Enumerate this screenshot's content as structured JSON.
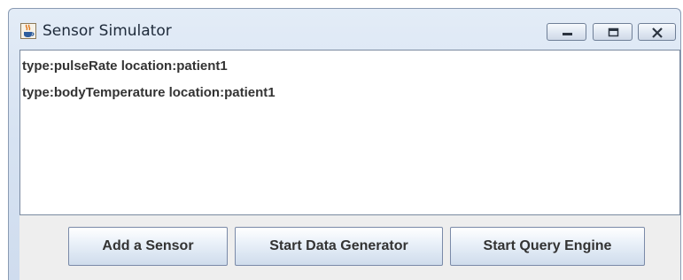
{
  "window": {
    "title": "Sensor Simulator",
    "controls": {
      "minimize_icon": "minimize-icon",
      "maximize_icon": "maximize-icon",
      "close_icon": "close-icon"
    }
  },
  "app_icon": "java-cup-icon",
  "sensor_list": {
    "items": [
      {
        "label": "type:pulseRate location:patient1"
      },
      {
        "label": "type:bodyTemperature location:patient1"
      }
    ]
  },
  "buttons": {
    "add_sensor": "Add a Sensor",
    "start_data_generator": "Start Data Generator",
    "start_query_engine": "Start Query Engine"
  },
  "colors": {
    "titlebar": "#dbe6f4",
    "panel": "#eeeeee",
    "text": "#333333",
    "icon_accent": "#e0761a"
  }
}
